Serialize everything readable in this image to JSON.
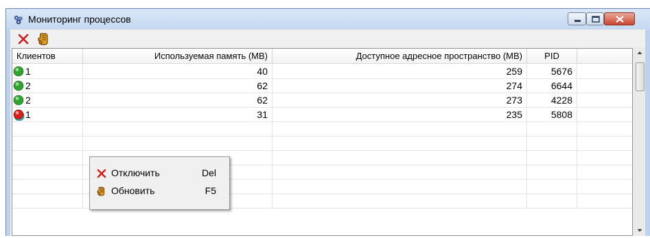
{
  "window": {
    "title": "Мониторинг процессов",
    "icon": "processes-app-icon"
  },
  "toolbar": {
    "buttons": [
      {
        "name": "disconnect",
        "icon": "red-x-icon"
      },
      {
        "name": "refresh",
        "icon": "refresh-hand-icon"
      }
    ]
  },
  "table": {
    "columns": [
      "Клиентов",
      "Используемая память (MB)",
      "Доступное адресное пространство (MB)",
      "PID",
      ""
    ],
    "rows": [
      {
        "status": "green",
        "clients": "1",
        "memory": "40",
        "address_space": "259",
        "pid": "5676"
      },
      {
        "status": "green",
        "clients": "2",
        "memory": "62",
        "address_space": "274",
        "pid": "6644"
      },
      {
        "status": "green",
        "clients": "2",
        "memory": "62",
        "address_space": "273",
        "pid": "4228"
      },
      {
        "status": "red",
        "clients": "1",
        "memory": "31",
        "address_space": "235",
        "pid": "5808"
      }
    ]
  },
  "context_menu": {
    "items": [
      {
        "label": "Отключить",
        "shortcut": "Del",
        "icon": "red-x-icon"
      },
      {
        "label": "Обновить",
        "shortcut": "F5",
        "icon": "refresh-hand-icon"
      }
    ]
  },
  "colors": {
    "status_green": "#2fa52f",
    "status_red": "#e01b1b",
    "titlebar": "#c4d8f1"
  }
}
